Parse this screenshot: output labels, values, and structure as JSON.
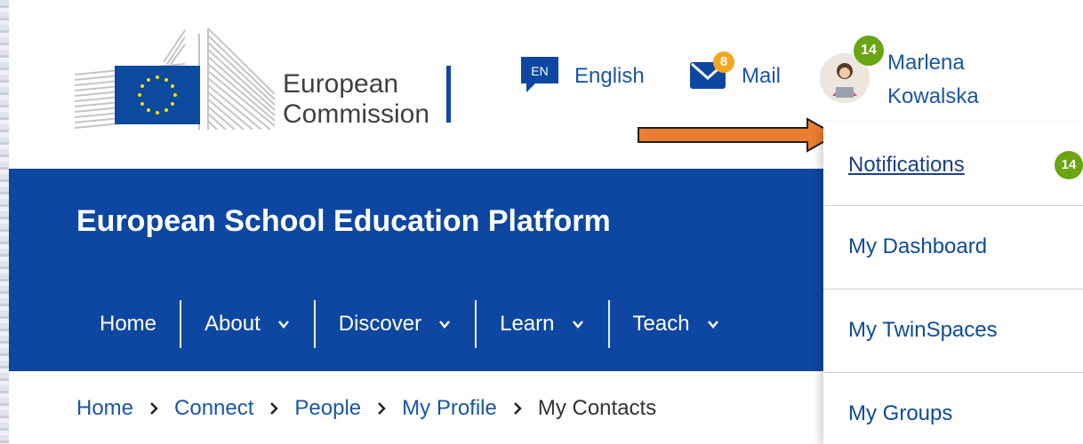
{
  "logo": {
    "line1": "European",
    "line2": "Commission"
  },
  "header": {
    "language": {
      "code": "EN",
      "label": "English"
    },
    "mail": {
      "label": "Mail",
      "count": "8"
    },
    "user": {
      "first_name": "Marlena",
      "last_name": "Kowalska",
      "notification_count": "14"
    }
  },
  "banner": {
    "title": "European School Education Platform",
    "nav": [
      {
        "label": "Home"
      },
      {
        "label": "About"
      },
      {
        "label": "Discover"
      },
      {
        "label": "Learn"
      },
      {
        "label": "Teach"
      }
    ]
  },
  "breadcrumb": [
    "Home",
    "Connect",
    "People",
    "My Profile",
    "My Contacts"
  ],
  "dropdown": {
    "items": [
      {
        "label": "Notifications",
        "badge": "14"
      },
      {
        "label": "My Dashboard"
      },
      {
        "label": "My TwinSpaces"
      },
      {
        "label": "My Groups"
      }
    ]
  },
  "colors": {
    "brand_blue": "#0e47a1",
    "link_blue": "#1a56a6",
    "badge_green": "#6aa513",
    "mail_badge_orange": "#f5a623",
    "arrow_orange": "#ed7d31"
  }
}
